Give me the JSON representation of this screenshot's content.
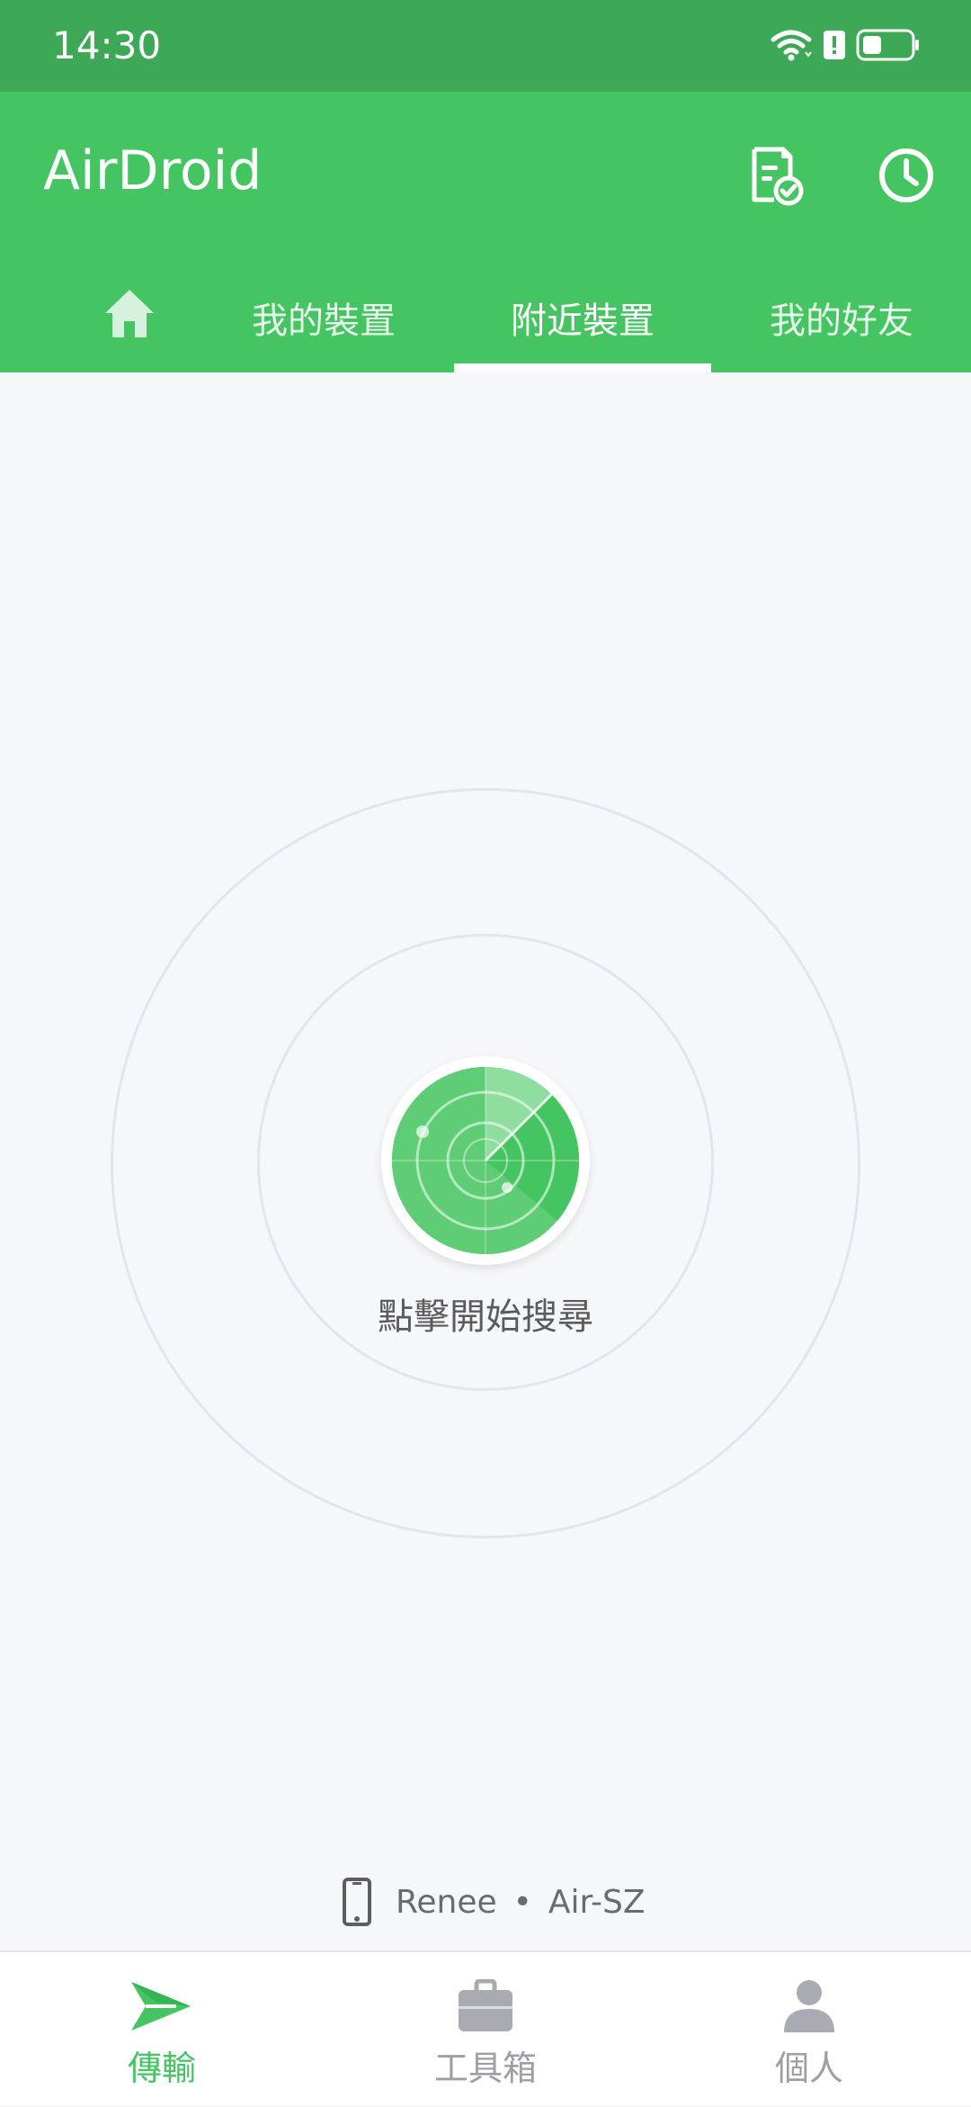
{
  "status_bar": {
    "time": "14:30",
    "icons": [
      "wifi-icon",
      "alert-icon",
      "battery-icon"
    ]
  },
  "app_bar": {
    "title": "AirDroid",
    "actions": [
      "file-check-icon",
      "history-clock-icon"
    ],
    "tabs": [
      {
        "icon": "home-icon"
      },
      {
        "label": "我的裝置"
      },
      {
        "label": "附近裝置"
      },
      {
        "label": "我的好友"
      }
    ],
    "active_tab": 2
  },
  "main": {
    "search_label": "點擊開始搜尋"
  },
  "device_info": {
    "user": "Renee",
    "separator": "•",
    "device": "Air-SZ"
  },
  "bottom_nav": {
    "items": [
      {
        "label": "傳輸",
        "icon": "send-icon",
        "active": true
      },
      {
        "label": "工具箱",
        "icon": "toolbox-icon",
        "active": false
      },
      {
        "label": "個人",
        "icon": "person-icon",
        "active": false
      }
    ]
  },
  "colors": {
    "status_bar": "#3da956",
    "primary": "#45c562",
    "background": "#f6f7fb",
    "inactive": "#9d9fa6"
  }
}
